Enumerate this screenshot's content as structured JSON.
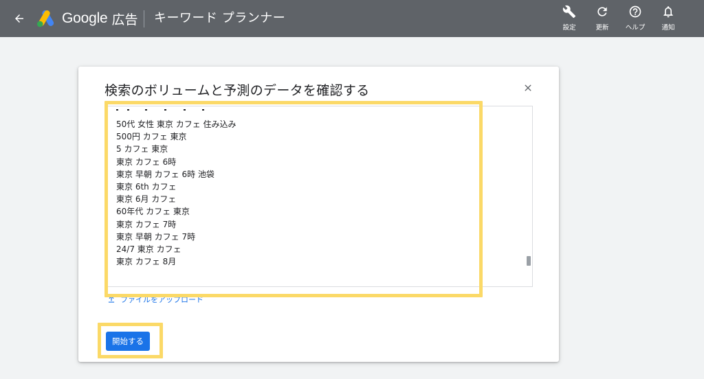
{
  "topbar": {
    "brand_google": "Google",
    "brand_ads": "広告",
    "page_title": "キーワード プランナー",
    "tools": [
      {
        "icon": "wrench-icon",
        "label": "設定"
      },
      {
        "icon": "refresh-icon",
        "label": "更新"
      },
      {
        "icon": "help-icon",
        "label": "ヘルプ"
      },
      {
        "icon": "bell-icon",
        "label": "通知"
      }
    ]
  },
  "dialog": {
    "title": "検索のボリュームと予測のデータを確認する",
    "keywords": [
      "50代 女性 東京 カフェ 住み込み",
      "500円 カフェ 東京",
      "5 カフェ 東京",
      "東京 カフェ 6時",
      "東京 早朝 カフェ 6時 池袋",
      "東京 6th カフェ",
      "東京 6月 カフェ",
      "60年代 カフェ 東京",
      "東京 カフェ 7時",
      "東京 早朝 カフェ 7時",
      "24/7 東京 カフェ",
      "東京 カフェ 8月"
    ],
    "upload_label": "ファイルをアップロード",
    "start_label": "開始する"
  },
  "colors": {
    "topbar": "#5f6368",
    "accent": "#1a73e8",
    "highlight": "#fbd967"
  }
}
